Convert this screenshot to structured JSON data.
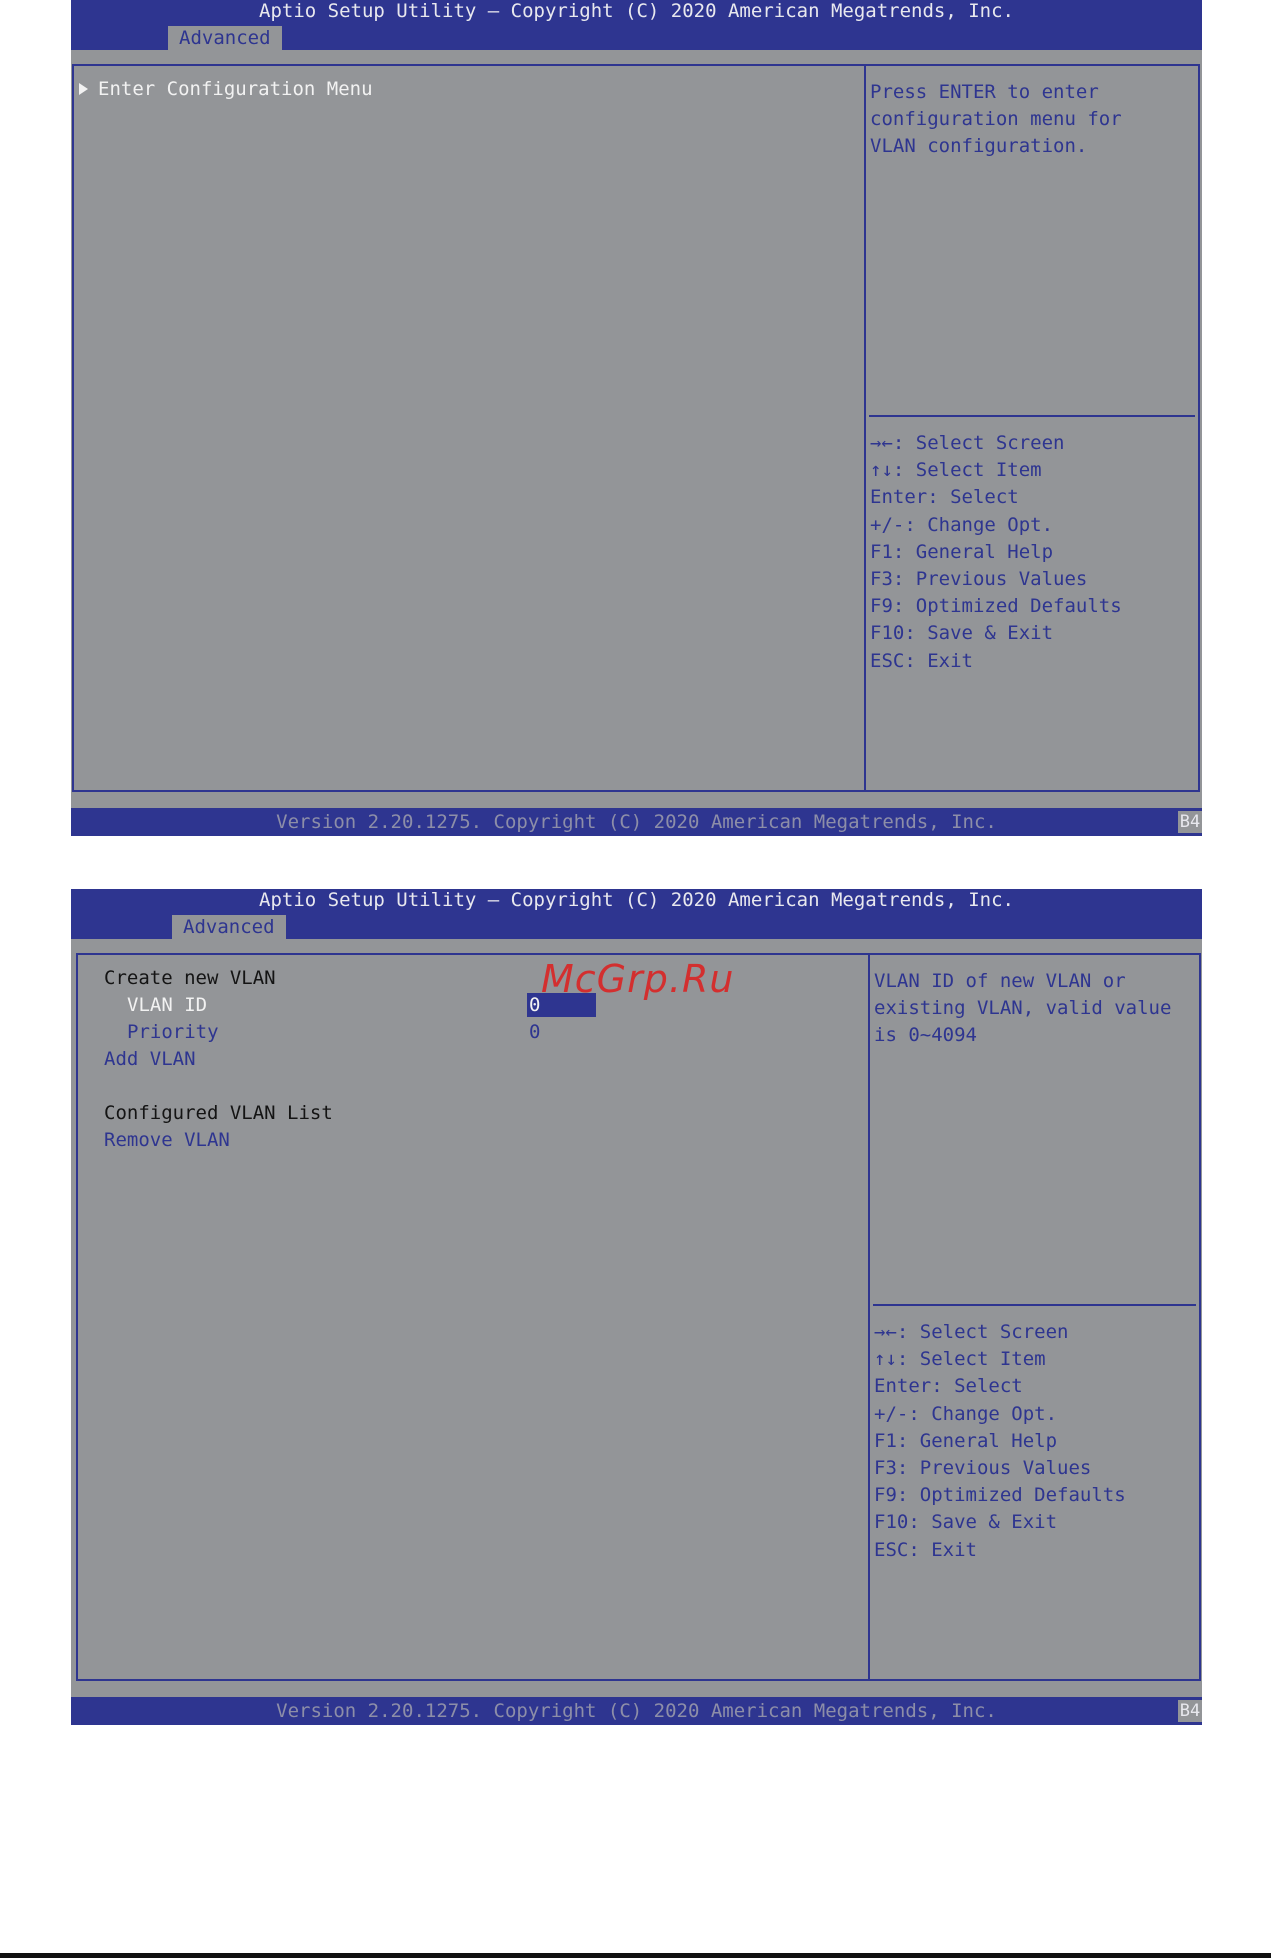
{
  "screens": [
    {
      "title": "Aptio Setup Utility – Copyright (C) 2020 American Megatrends, Inc.",
      "tab": "Advanced",
      "menu": [
        {
          "label": "Enter Configuration Menu"
        }
      ],
      "help": [
        "Press ENTER to enter",
        "configuration menu for",
        "VLAN configuration."
      ],
      "keys": [
        "→←: Select Screen",
        "↑↓: Select Item",
        "Enter: Select",
        "+/-: Change Opt.",
        "F1: General Help",
        "F3: Previous Values",
        "F9: Optimized Defaults",
        "F10: Save & Exit",
        "ESC: Exit"
      ],
      "footer": "Version 2.20.1275. Copyright (C) 2020 American Megatrends, Inc.",
      "badge": "B4"
    },
    {
      "title": "Aptio Setup Utility – Copyright (C) 2020 American Megatrends, Inc.",
      "tab": "Advanced",
      "menu": [
        {
          "label": "Create new VLAN"
        },
        {
          "label": "VLAN ID",
          "value": "0"
        },
        {
          "label": "Priority",
          "value": "0"
        },
        {
          "label": "Add VLAN"
        },
        {
          "label": "Configured VLAN List"
        },
        {
          "label": "Remove VLAN"
        }
      ],
      "help": [
        "VLAN ID of new VLAN or",
        "existing VLAN, valid value",
        "is 0~4094"
      ],
      "keys": [
        "→←: Select Screen",
        "↑↓: Select Item",
        "Enter: Select",
        "+/-: Change Opt.",
        "F1: General Help",
        "F3: Previous Values",
        "F9: Optimized Defaults",
        "F10: Save & Exit",
        "ESC: Exit"
      ],
      "footer": "Version 2.20.1275. Copyright (C) 2020 American Megatrends, Inc.",
      "badge": "B4"
    }
  ],
  "watermark": "McGrp.Ru"
}
